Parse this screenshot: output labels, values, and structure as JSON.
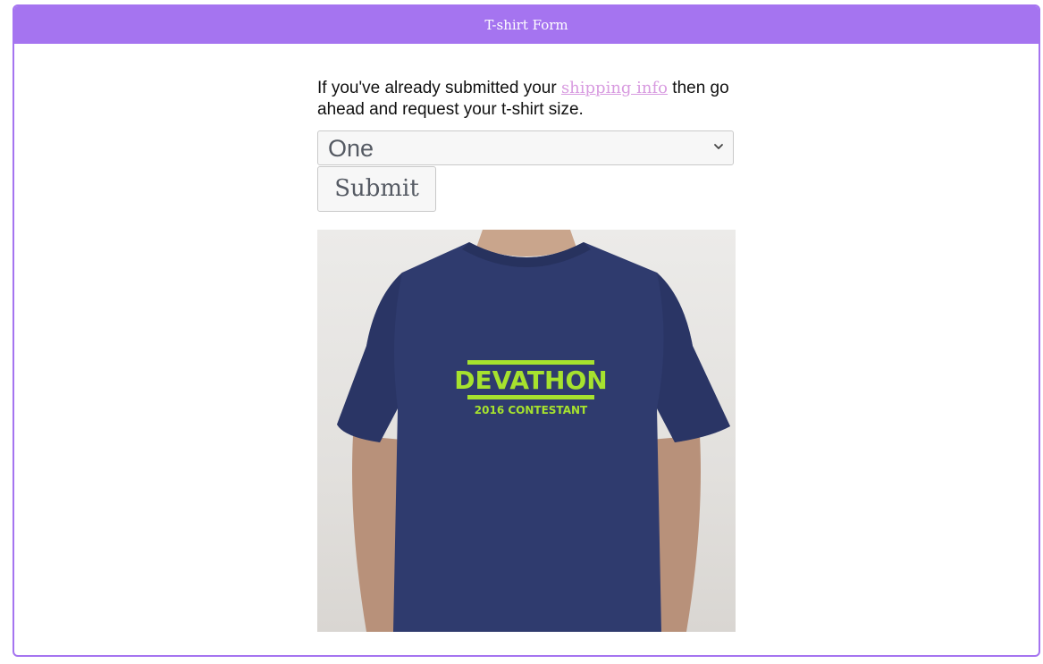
{
  "panel": {
    "title": "T-shirt Form"
  },
  "form": {
    "intro_before": "If you've already submitted your ",
    "intro_link": "shipping info",
    "intro_after": " then go ahead and request your t-shirt size.",
    "size_select": {
      "selected": "One"
    },
    "submit_label": "Submit"
  },
  "shirt_image": {
    "print_title": "DEVATHON",
    "print_subtitle": "2016 CONTESTANT",
    "shirt_color": "#2e3a6b",
    "print_color": "#a6e22e"
  },
  "colors": {
    "accent": "#a574f0",
    "link": "#d89be0"
  }
}
